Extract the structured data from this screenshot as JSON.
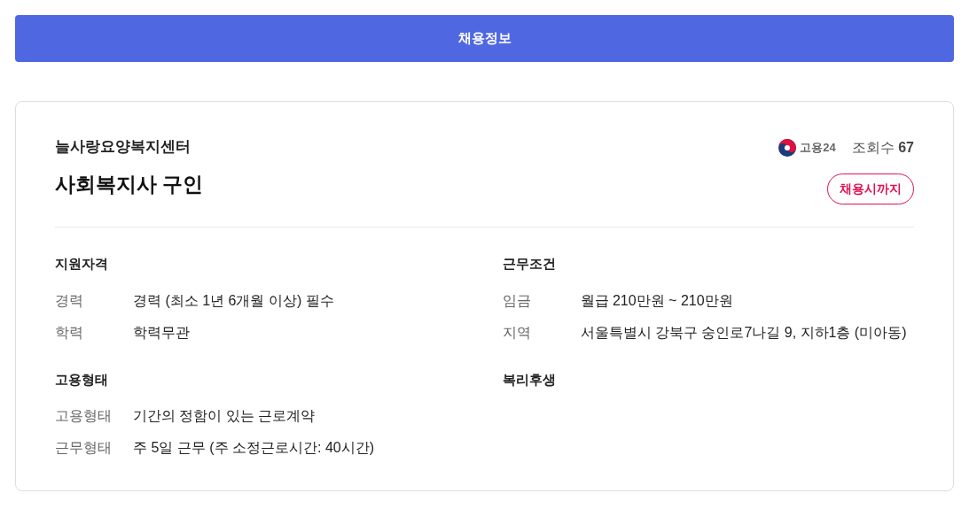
{
  "header_button": {
    "label": "채용정보"
  },
  "card": {
    "company": "늘사랑요양복지센터",
    "title": "사회복지사 구인",
    "source": "고용24",
    "views": {
      "label": "조회수",
      "value": "67"
    },
    "deadline_badge": "채용시까지",
    "sections": [
      {
        "title": "지원자격",
        "rows": [
          {
            "label": "경력",
            "value": "경력 (최소 1년 6개월 이상) 필수"
          },
          {
            "label": "학력",
            "value": "학력무관"
          }
        ]
      },
      {
        "title": "근무조건",
        "rows": [
          {
            "label": "임금",
            "value": "월급 210만원 ~ 210만원"
          },
          {
            "label": "지역",
            "value": "서울특별시 강북구 숭인로7나길 9, 지하1층 (미아동)"
          }
        ]
      },
      {
        "title": "고용형태",
        "rows": [
          {
            "label": "고용형태",
            "value": "기간의 정함이 있는 근로계약"
          },
          {
            "label": "근무형태",
            "value": "주 5일 근무 (주 소정근로시간: 40시간)"
          }
        ]
      },
      {
        "title": "복리후생"
      }
    ]
  }
}
